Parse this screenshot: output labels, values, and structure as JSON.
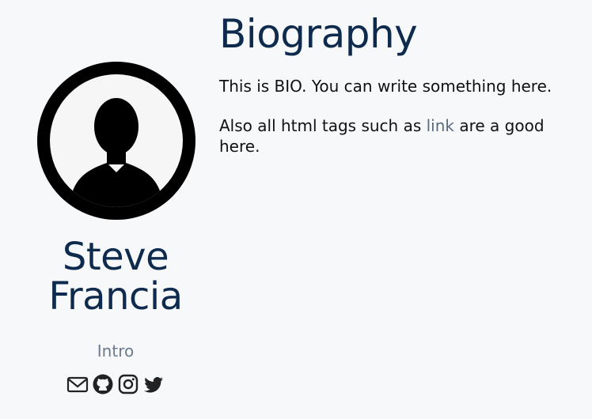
{
  "sidebar": {
    "avatar_icon": "person-silhouette-icon",
    "name_first": "Steve",
    "name_last": "Francia",
    "intro_link": "Intro",
    "social": [
      {
        "icon": "mail-icon"
      },
      {
        "icon": "github-icon"
      },
      {
        "icon": "instagram-icon"
      },
      {
        "icon": "twitter-icon"
      }
    ]
  },
  "main": {
    "title": "Biography",
    "paragraph1": "This is BIO. You can write something here.",
    "paragraph2_before": "Also all html tags such as ",
    "paragraph2_link": "link",
    "paragraph2_after": " are a good here."
  },
  "colors": {
    "background": "#f7f8fa",
    "heading": "#0e2a4d",
    "muted_link": "#6c7a8d"
  }
}
